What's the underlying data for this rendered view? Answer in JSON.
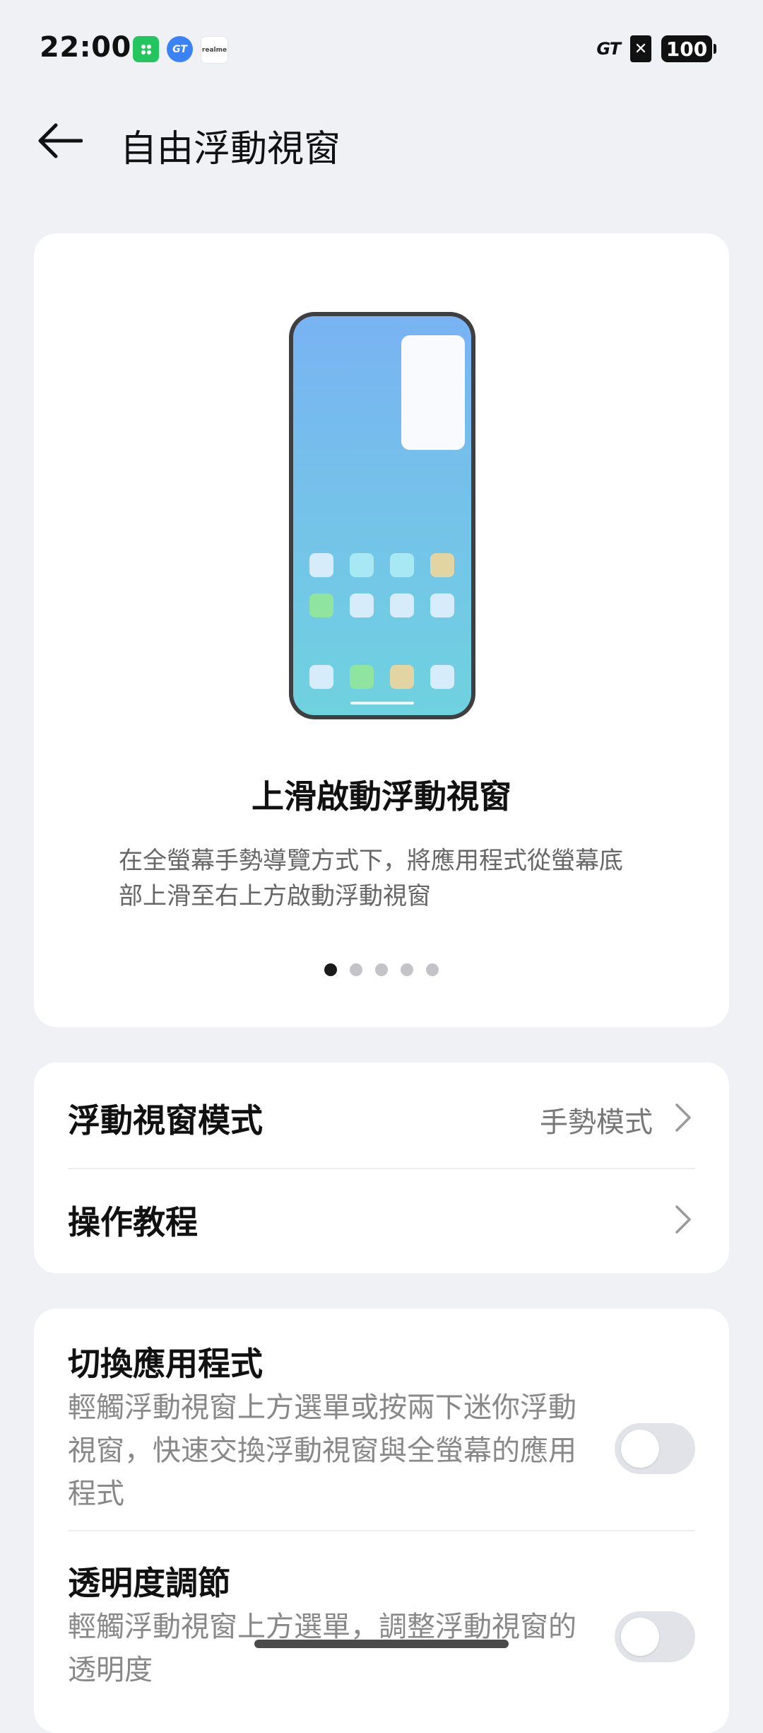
{
  "status_bar": {
    "time": "22:00",
    "app_icons": [
      {
        "icon": "store-icon",
        "color": "#22c55e"
      },
      {
        "icon": "gt-icon",
        "color": "#3b82f6",
        "label": "GT"
      },
      {
        "icon": "realme-icon",
        "color": "#ffffff",
        "label": "realme"
      }
    ],
    "gt_badge": "GT",
    "sim_label": "✕",
    "battery": "100"
  },
  "header": {
    "title": "自由浮動視窗"
  },
  "carousel": {
    "title": "上滑啟動浮動視窗",
    "description": "在全螢幕手勢導覽方式下，將應用程式從螢幕底部上滑至右上方啟動浮動視窗",
    "page_count": 5,
    "active_index": 0
  },
  "settings": {
    "floating_mode": {
      "label": "浮動視窗模式",
      "value": "手勢模式"
    },
    "tutorial": {
      "label": "操作教程"
    },
    "switch_apps": {
      "label": "切換應用程式",
      "description": "輕觸浮動視窗上方選單或按兩下迷你浮動視窗，快速交換浮動視窗與全螢幕的應用程式",
      "enabled": false
    },
    "transparency": {
      "label": "透明度調節",
      "description": "輕觸浮動視窗上方選單，調整浮動視窗的透明度",
      "enabled": false
    }
  },
  "colors": {
    "background": "#f0f1f5",
    "card": "#ffffff",
    "toggle_off": "#e2e3e8"
  }
}
